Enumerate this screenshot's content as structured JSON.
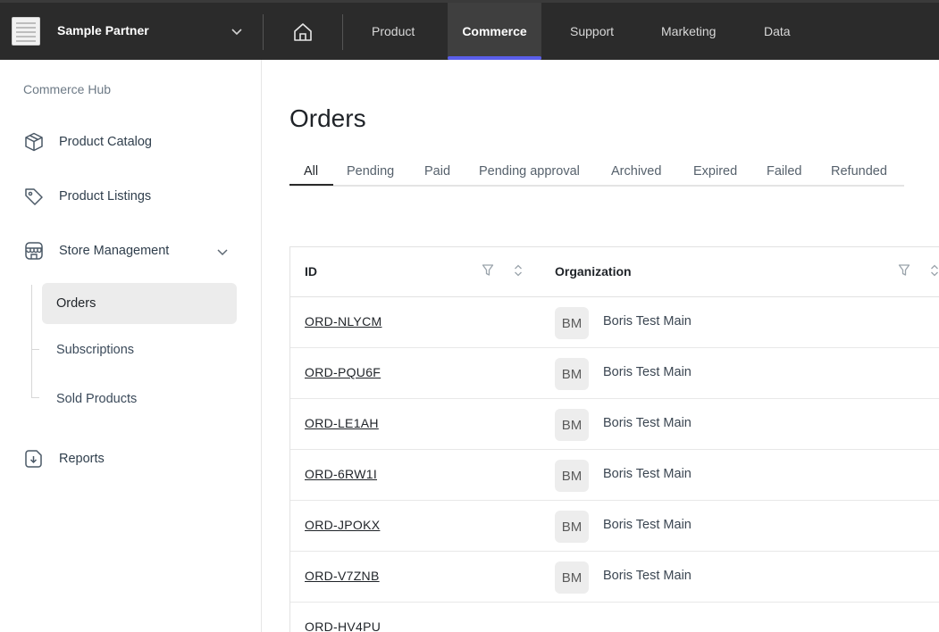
{
  "header": {
    "partner_name": "Sample Partner",
    "nav": [
      "Product",
      "Commerce",
      "Support",
      "Marketing",
      "Data"
    ],
    "active_nav": "Commerce"
  },
  "sidebar": {
    "hub_label": "Commerce Hub",
    "items": [
      {
        "label": "Product Catalog",
        "icon": "box-icon"
      },
      {
        "label": "Product Listings",
        "icon": "tag-icon"
      },
      {
        "label": "Store Management",
        "icon": "store-icon"
      },
      {
        "label": "Reports",
        "icon": "report-icon"
      }
    ],
    "sub_items": [
      "Orders",
      "Subscriptions",
      "Sold Products"
    ],
    "active_sub": "Orders"
  },
  "main": {
    "title": "Orders",
    "tabs": [
      "All",
      "Pending",
      "Paid",
      "Pending approval",
      "Archived",
      "Expired",
      "Failed",
      "Refunded"
    ],
    "active_tab": "All",
    "table": {
      "columns": [
        "ID",
        "Organization"
      ],
      "rows": [
        {
          "id": "ORD-NLYCM",
          "avatar": "BM",
          "org": "Boris Test Main"
        },
        {
          "id": "ORD-PQU6F",
          "avatar": "BM",
          "org": "Boris Test Main"
        },
        {
          "id": "ORD-LE1AH",
          "avatar": "BM",
          "org": "Boris Test Main"
        },
        {
          "id": "ORD-6RW1I",
          "avatar": "BM",
          "org": "Boris Test Main"
        },
        {
          "id": "ORD-JPOKX",
          "avatar": "BM",
          "org": "Boris Test Main"
        },
        {
          "id": "ORD-V7ZNB",
          "avatar": "BM",
          "org": "Boris Test Main"
        },
        {
          "id": "ORD-HV4PU",
          "avatar": "",
          "org": ""
        }
      ]
    }
  },
  "colors": {
    "topbar": "#2b2b2b",
    "accent": "#5a5eea",
    "active_sub_bg": "#ececec"
  }
}
